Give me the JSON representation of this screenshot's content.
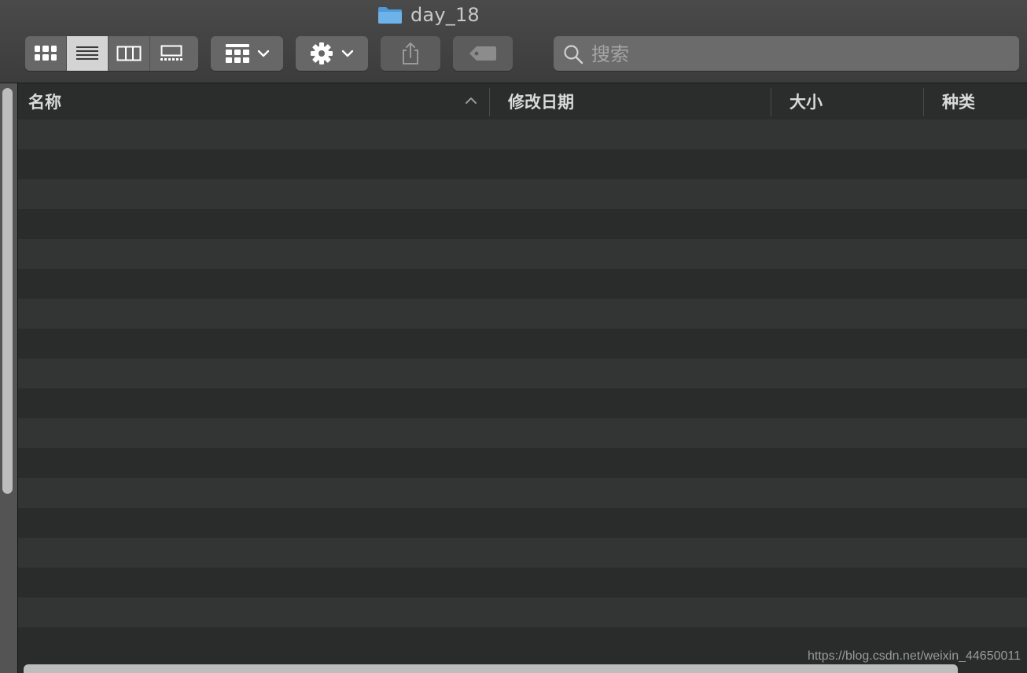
{
  "window": {
    "title": "day_18",
    "folder_color": "#5aa6e0"
  },
  "toolbar": {
    "view_modes": [
      {
        "name": "icon-view",
        "active": false
      },
      {
        "name": "list-view",
        "active": true
      },
      {
        "name": "column-view",
        "active": false
      },
      {
        "name": "gallery-view",
        "active": false
      }
    ],
    "group_button_icon": "group-grid-icon",
    "action_button_icon": "gear-icon",
    "share_button_icon": "share-icon",
    "tag_button_icon": "tag-icon"
  },
  "search": {
    "placeholder": "搜索",
    "value": ""
  },
  "columns": [
    {
      "label": "名称",
      "sorted": "ascending"
    },
    {
      "label": "修改日期"
    },
    {
      "label": "大小"
    },
    {
      "label": "种类"
    }
  ],
  "rows_count": 18,
  "watermark": "https://blog.csdn.net/weixin_44650011"
}
